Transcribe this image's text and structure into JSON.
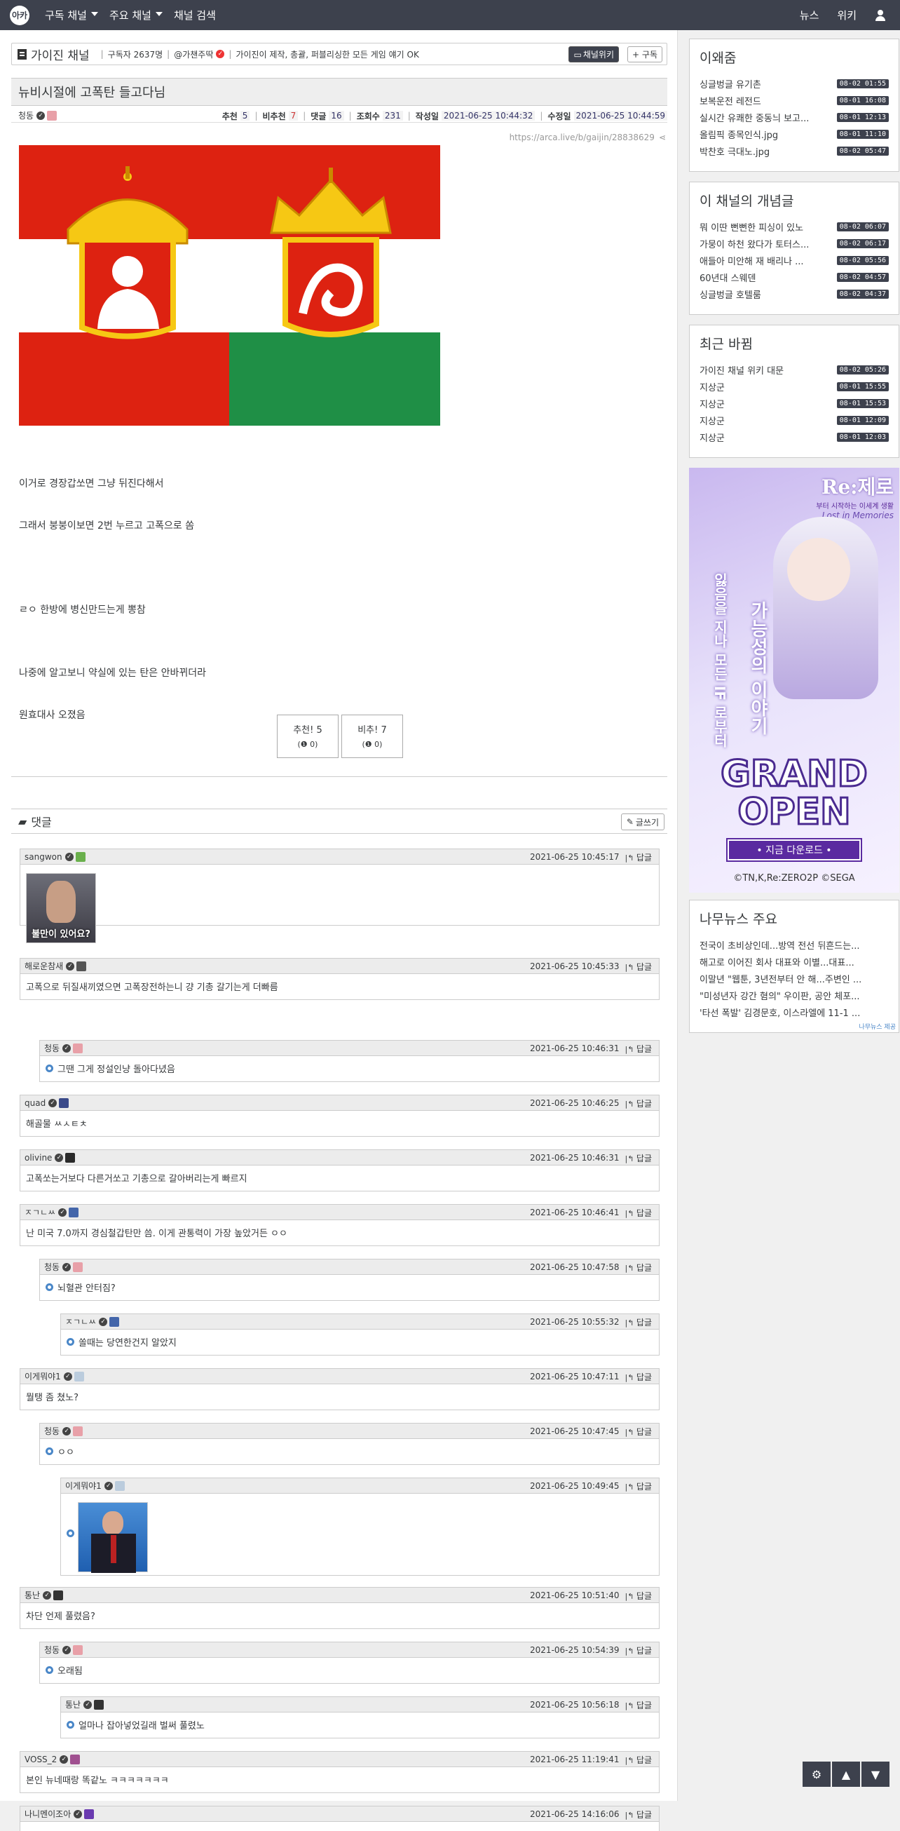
{
  "nav": {
    "logo": "아카",
    "items": [
      "구독 채널",
      "주요 채널",
      "채널 검색"
    ],
    "right": [
      "뉴스",
      "위키"
    ]
  },
  "channel": {
    "name": "가이진 채널",
    "subscribers": "구독자 2637명",
    "owner": "@가챈주딱",
    "desc": "가이진이 제작, 총괄, 퍼블리싱한 모든 게임 얘기 OK",
    "wiki_btn": "채널위키",
    "sub_btn": "+ 구독"
  },
  "post": {
    "title": "뉴비시절에 고폭탄 들고다님",
    "author": "청동",
    "stats": {
      "rec_label": "추천",
      "rec": "5",
      "unrec_label": "비추천",
      "unrec": "7",
      "cmt_label": "댓글",
      "cmt": "16",
      "view_label": "조회수",
      "view": "231",
      "created_label": "작성일",
      "created": "2021-06-25 10:44:32",
      "edited_label": "수정일",
      "edited": "2021-06-25 10:44:59"
    },
    "url": "https://arca.live/b/gaijin/28838629",
    "lines": [
      "이거로 경장갑쏘면 그냥 뒤진다해서",
      "그래서 붕붕이보면 2번 누르고 고폭으로 쏨",
      "ㄹㅇ 한방에 병신만드는게 뽕참",
      "나중에 알고보니 약실에 있는 탄은 안바뀌더라",
      "원효대사 오졌음"
    ],
    "vote_up": "추천! 5",
    "vote_up_sub": "(❶ 0)",
    "vote_down": "비추! 7",
    "vote_down_sub": "(❶ 0)"
  },
  "comments_header": {
    "title": "댓글",
    "write": "글쓰기"
  },
  "reply_label": "답글",
  "comments": [
    {
      "author": "sangwon",
      "time": "2021-06-25 10:45:17",
      "text": "",
      "img_caption": "불만이 있어요?"
    },
    {
      "author": "해로운참새",
      "time": "2021-06-25 10:45:33",
      "text": "고폭으로 뒤질새끼였으면 고폭장전하는니 걍 기총 갈기는게 더빠름"
    },
    {
      "author": "청동",
      "time": "2021-06-25 10:46:31",
      "text": "그땐 그게 정설인냥 돌아다녔음"
    },
    {
      "author": "quad",
      "time": "2021-06-25 10:46:25",
      "text": "해골물 ㅆㅅㅌㅊ"
    },
    {
      "author": "olivine",
      "time": "2021-06-25 10:46:31",
      "text": "고폭쏘는거보다 다른거쏘고 기총으로 갈아버리는게 빠르지"
    },
    {
      "author": "ㅈㄱㄴㅆ",
      "time": "2021-06-25 10:46:41",
      "text": "난 미국 7.0까지 경심철갑탄만 씀. 이게 관통력이 가장 높았거든 ㅇㅇ"
    },
    {
      "author": "청동",
      "time": "2021-06-25 10:47:58",
      "text": "뇌혈관 안터짐?"
    },
    {
      "author": "ㅈㄱㄴㅆ",
      "time": "2021-06-25 10:55:32",
      "text": "쏠때는 당연한건지 알았지"
    },
    {
      "author": "이게뭐야1",
      "time": "2021-06-25 10:47:11",
      "text": "뭘탱 좀 쳤노?"
    },
    {
      "author": "청동",
      "time": "2021-06-25 10:47:45",
      "text": "ㅇㅇ"
    },
    {
      "author": "이게뭐야1",
      "time": "2021-06-25 10:49:45",
      "text": ""
    },
    {
      "author": "통난",
      "time": "2021-06-25 10:51:40",
      "text": "차단 언제 풀렸음?"
    },
    {
      "author": "청동",
      "time": "2021-06-25 10:54:39",
      "text": "오래됨"
    },
    {
      "author": "통난",
      "time": "2021-06-25 10:56:18",
      "text": "얼마나 잡아넣었길래 벌써 풀렸노"
    },
    {
      "author": "VOSS_2",
      "time": "2021-06-25 11:19:41",
      "text": "본인 뉴네때랑 똑같노 ㅋㅋㅋㅋㅋㅋㅋ"
    },
    {
      "author": "나니멘이조아",
      "time": "2021-06-25 14:16:06",
      "text": ""
    }
  ],
  "sidebar": {
    "hot": {
      "title": "이왜줌",
      "items": [
        {
          "t": "싱글벙글 유기촌",
          "d": "08-02 01:55"
        },
        {
          "t": "보복운전 레전드",
          "d": "08-01 16:08"
        },
        {
          "t": "실시간 유쾌한 중동늬 보고...",
          "d": "08-01 12:13"
        },
        {
          "t": "올림픽 종목인식.jpg",
          "d": "08-01 11:10"
        },
        {
          "t": "박찬호 극대노.jpg",
          "d": "08-02 05:47"
        }
      ]
    },
    "best": {
      "title": "이 채널의 개념글",
      "items": [
        {
          "t": "뭐 이딴 뻔뻔한 피싱이 있노",
          "d": "08-02 06:07"
        },
        {
          "t": "가뭉이 하천 왔다가 토터스...",
          "d": "08-02 06:17"
        },
        {
          "t": "애들아 미안해 재 배리나 ...",
          "d": "08-02 05:56"
        },
        {
          "t": "60년대 스웨덴",
          "d": "08-02 04:57"
        },
        {
          "t": "싱글벙글 호텔룸",
          "d": "08-02 04:37"
        }
      ]
    },
    "recent": {
      "title": "최근 바뀜",
      "items": [
        {
          "t": "가이진 채널 위키 대문",
          "d": "08-02 05:26"
        },
        {
          "t": "지상군",
          "d": "08-01 15:55"
        },
        {
          "t": "지상군",
          "d": "08-01 15:53"
        },
        {
          "t": "지상군",
          "d": "08-01 12:09"
        },
        {
          "t": "지상군",
          "d": "08-01 12:03"
        }
      ]
    },
    "ad": {
      "logo1": "Re:제로",
      "logo2": "부터 시작하는 이세계 생활",
      "logo3": "Lost in Memories",
      "v1": "가능성의 이야기",
      "v2": "잃음을 지나 모든 IF 로부터",
      "grand": "GRAND",
      "open": "OPEN",
      "cta": "• 지금 다운로드 •",
      "copy": "©TN,K,Re:ZERO2P ©SEGA"
    },
    "news": {
      "title": "나무뉴스 주요",
      "items": [
        "전국이 초비상인데...방역 전선 뒤흔드는...",
        "해고로 이어진 회사 대표와 이별...대표...",
        "이말년 \"웹툰, 3년전부터 안 해...주변인 ...",
        "\"미성년자 강간 혐의\" 우이판, 공안 체포...",
        "'타선 폭발' 김경문호, 이스라엘에 11-1 ..."
      ],
      "credit": "나무뉴스 제공"
    }
  },
  "colors": {
    "nav": "#3d414d",
    "accent": "#4a87c8"
  }
}
